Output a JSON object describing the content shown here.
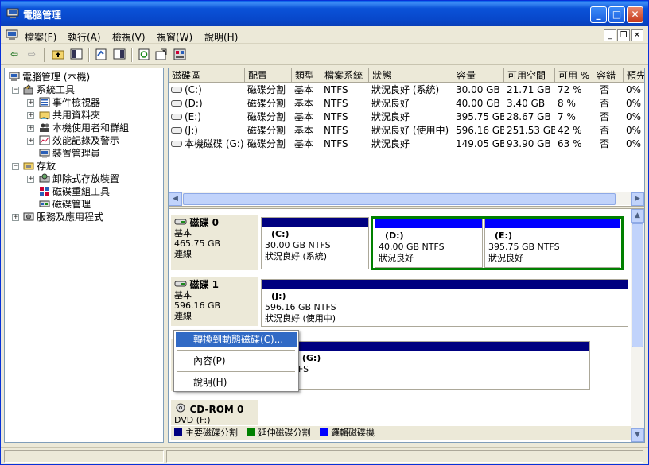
{
  "window": {
    "title": "電腦管理",
    "min": "_",
    "max": "□",
    "close": "✕"
  },
  "menu": {
    "items": [
      "檔案(F)",
      "執行(A)",
      "檢視(V)",
      "視窗(W)",
      "說明(H)"
    ],
    "mdi_min": "_",
    "mdi_restore": "❐",
    "mdi_close": "✕"
  },
  "toolbar": {
    "back": "⇦",
    "forward": "⇨"
  },
  "tree": {
    "root": "電腦管理 (本機)",
    "system_tools": "系統工具",
    "event_viewer": "事件檢視器",
    "shared_folders": "共用資料夾",
    "local_users": "本機使用者和群組",
    "perf_logs": "效能記錄及警示",
    "device_manager": "裝置管理員",
    "storage": "存放",
    "removable": "卸除式存放裝置",
    "defrag": "磁碟重組工具",
    "disk_mgmt": "磁碟管理",
    "services": "服務及應用程式",
    "plus": "+",
    "minus": "−"
  },
  "volumes": {
    "headers": [
      "磁碟區",
      "配置",
      "類型",
      "檔案系統",
      "狀態",
      "容量",
      "可用空間",
      "可用 %",
      "容錯",
      "預先"
    ],
    "rows": [
      [
        "(C:)",
        "磁碟分割",
        "基本",
        "NTFS",
        "狀況良好 (系統)",
        "30.00 GB",
        "21.71 GB",
        "72 %",
        "否",
        "0%"
      ],
      [
        "(D:)",
        "磁碟分割",
        "基本",
        "NTFS",
        "狀況良好",
        "40.00 GB",
        "3.40 GB",
        "8 %",
        "否",
        "0%"
      ],
      [
        "(E:)",
        "磁碟分割",
        "基本",
        "NTFS",
        "狀況良好",
        "395.75 GB",
        "28.67 GB",
        "7 %",
        "否",
        "0%"
      ],
      [
        "(J:)",
        "磁碟分割",
        "基本",
        "NTFS",
        "狀況良好 (使用中)",
        "596.16 GB",
        "251.53 GB",
        "42 %",
        "否",
        "0%"
      ],
      [
        "本機磁碟 (G:)",
        "磁碟分割",
        "基本",
        "NTFS",
        "狀況良好",
        "149.05 GB",
        "93.90 GB",
        "63 %",
        "否",
        "0%"
      ]
    ]
  },
  "disks": {
    "disk0": {
      "name": "磁碟 0",
      "type": "基本",
      "size": "465.75 GB",
      "status": "連線"
    },
    "disk1": {
      "name": "磁碟 1",
      "type": "基本",
      "size": "596.16 GB",
      "status": "連線"
    },
    "disk2": {
      "type": "基",
      "size": "1",
      "status": "連"
    },
    "cdrom": {
      "name": "CD-ROM 0",
      "type": "DVD (F:)"
    },
    "parts": {
      "c": {
        "name": "(C:)",
        "info": "30.00 GB NTFS",
        "status": "狀況良好 (系統)"
      },
      "d": {
        "name": "(D:)",
        "info": "40.00 GB NTFS",
        "status": "狀況良好"
      },
      "e": {
        "name": "(E:)",
        "info": "395.75 GB NTFS",
        "status": "狀況良好"
      },
      "j": {
        "name": "(J:)",
        "info": "596.16 GB NTFS",
        "status": "狀況良好 (使用中)"
      },
      "g": {
        "name": "碟  (G:)",
        "info": "B NTFS",
        "status": "好"
      }
    }
  },
  "legend": {
    "primary": "主要磁碟分割",
    "extended": "延伸磁碟分割",
    "logical": "邏輯磁碟機",
    "colors": {
      "primary": "#000080",
      "extended": "#008000",
      "logical": "#0000ff"
    }
  },
  "context_menu": {
    "convert": "轉換到動態磁碟(C)...",
    "properties": "內容(P)",
    "help": "說明(H)"
  }
}
